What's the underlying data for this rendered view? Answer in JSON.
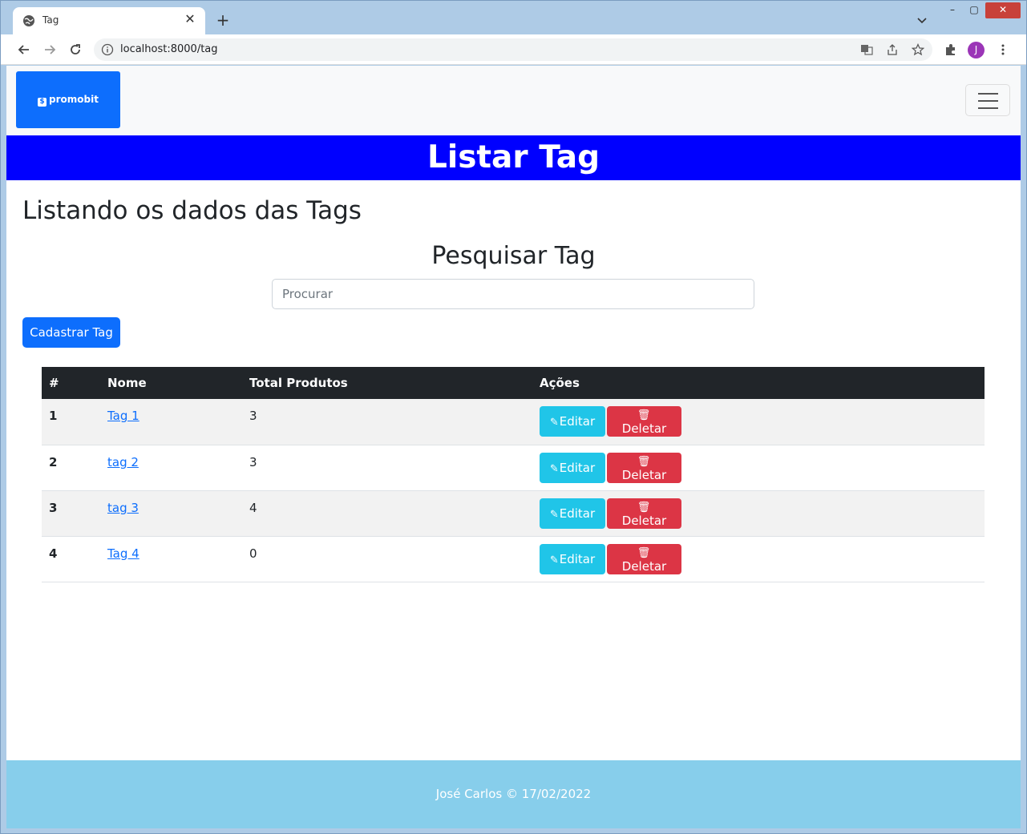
{
  "browser": {
    "tab_title": "Tag",
    "tab_close": "✕",
    "new_tab": "+",
    "url": "localhost:8000/tag",
    "avatar_letter": "J",
    "window_controls": {
      "minimize": "–",
      "maximize": "▢",
      "close": "✕"
    }
  },
  "navbar": {
    "brand": "promobit",
    "brand_glyph": "$"
  },
  "hero": {
    "title": "Listar Tag"
  },
  "main": {
    "heading": "Listando os dados das Tags",
    "search_heading": "Pesquisar Tag",
    "search_placeholder": "Procurar",
    "create_button": "Cadastrar Tag"
  },
  "table": {
    "headers": [
      "#",
      "Nome",
      "Total Produtos",
      "Ações"
    ],
    "rows": [
      {
        "id": "1",
        "name": "Tag 1",
        "total": "3"
      },
      {
        "id": "2",
        "name": "tag 2",
        "total": "3"
      },
      {
        "id": "3",
        "name": "tag 3",
        "total": "4"
      },
      {
        "id": "4",
        "name": "Tag 4",
        "total": "0"
      }
    ],
    "edit_label": "Editar",
    "delete_label": "Deletar"
  },
  "footer": {
    "text": "José Carlos © 17/02/2022"
  },
  "colors": {
    "hero_bg": "#0000ff",
    "primary": "#0d6efd",
    "info": "#20c5e8",
    "danger": "#dc3545",
    "footer_bg": "#87ceeb"
  }
}
